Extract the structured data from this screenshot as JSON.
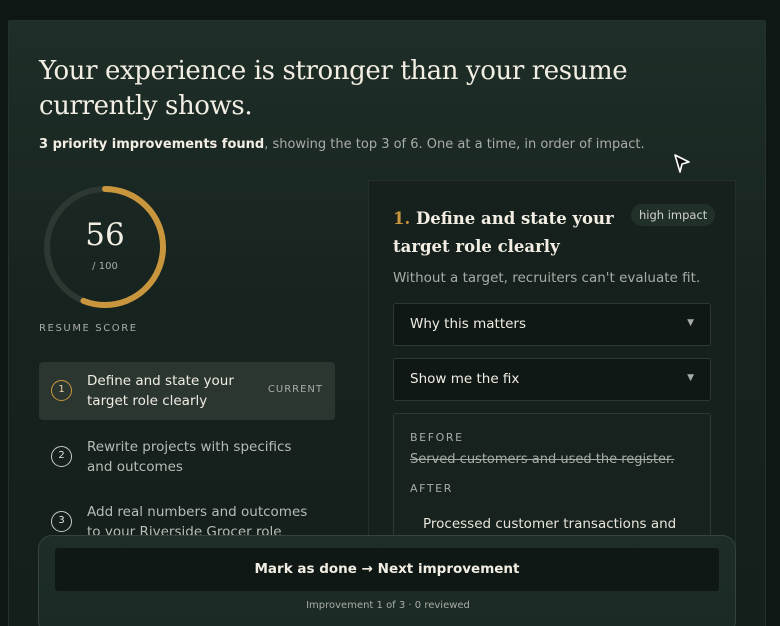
{
  "header": {
    "headline": "Your experience is stronger than your resume currently shows.",
    "summary_bold": "3 priority improvements found",
    "summary_rest": ", showing the top 3 of 6. One at a time, in order of impact."
  },
  "score": {
    "value": "56",
    "max": "/ 100",
    "label": "RESUME SCORE",
    "fraction": 0.56,
    "accent_color": "#c9963d"
  },
  "steps": [
    {
      "number": "1",
      "title": "Define and state your target role clearly",
      "badge": "CURRENT"
    },
    {
      "number": "2",
      "title": "Rewrite projects with specifics and outcomes",
      "badge": ""
    },
    {
      "number": "3",
      "title": "Add real numbers and outcomes to your Riverside Grocer role",
      "badge": ""
    }
  ],
  "detail": {
    "number": "1.",
    "title": "Define and state your target role clearly",
    "impact": "high impact",
    "subtitle": "Without a target, recruiters can't evaluate fit.",
    "why_label": "Why this matters",
    "fix_label": "Show me the fix",
    "caret": "▼",
    "before_label": "BEFORE",
    "before_text": "Served customers and used the register.",
    "after_label": "AFTER",
    "after_text": "Processed customer transactions and"
  },
  "footer": {
    "cta_label": "Mark as done → Next improvement",
    "progress_text": "Improvement 1 of 3 · 0 reviewed"
  }
}
